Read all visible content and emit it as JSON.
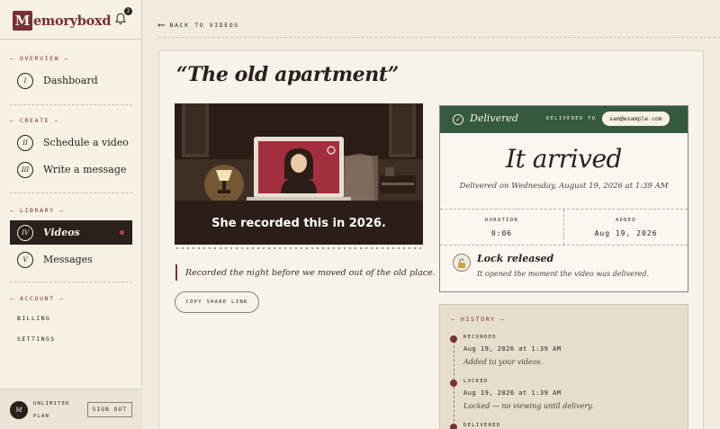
{
  "brand": {
    "letter": "M",
    "rest": "emoryboxd"
  },
  "notifications": {
    "count": "2"
  },
  "sidebar": {
    "sections": [
      {
        "label": "— OVERVIEW —"
      },
      {
        "label": "— CREATE —"
      },
      {
        "label": "— LIBRARY —"
      },
      {
        "label": "— ACCOUNT —"
      }
    ],
    "items": [
      {
        "num": "I",
        "label": "Dashboard"
      },
      {
        "num": "II",
        "label": "Schedule a video"
      },
      {
        "num": "III",
        "label": "Write a message"
      },
      {
        "num": "IV",
        "label": "Videos"
      },
      {
        "num": "V",
        "label": "Messages"
      }
    ],
    "account_links": [
      "BILLING",
      "SETTINGS"
    ],
    "footer": {
      "avatar": "M",
      "plan_line1": "UNLIMITED",
      "plan_line2": "PLAN",
      "sign_out": "SIGN OUT"
    }
  },
  "back_link": {
    "arrow": "⟵",
    "label": "BACK TO VIDEOS"
  },
  "video": {
    "title": "“The old apartment”",
    "thumbnail_caption": "She recorded this in 2026.",
    "note": "Recorded the night before we moved out of the old place.",
    "share_label": "COPY SHARE LINK"
  },
  "delivery": {
    "status": "Delivered",
    "to_label": "DELIVERED TO",
    "email": "sam@example.com",
    "headline": "It arrived",
    "delivered_on": "Delivered on Wednesday, August 19, 2026 at 1:39 AM",
    "stats": [
      {
        "label": "DURATION",
        "value": "0:06"
      },
      {
        "label": "ADDED",
        "value": "Aug 19, 2026"
      }
    ],
    "lock_title": "Lock released",
    "lock_desc": "It opened the moment the video was delivered."
  },
  "history": {
    "title": "— HISTORY —",
    "events": [
      {
        "label": "RECORDED",
        "time": "Aug 19, 2026 at 1:39 AM",
        "desc": "Added to your videos."
      },
      {
        "label": "LOCKED",
        "time": "Aug 19, 2026 at 1:39 AM",
        "desc": "Locked — no viewing until delivery."
      },
      {
        "label": "DELIVERED"
      }
    ]
  },
  "colors": {
    "accent": "#7a2f35",
    "delivered_green": "#355a3f",
    "ink": "#2a211c",
    "paper": "#f1ebdf"
  }
}
